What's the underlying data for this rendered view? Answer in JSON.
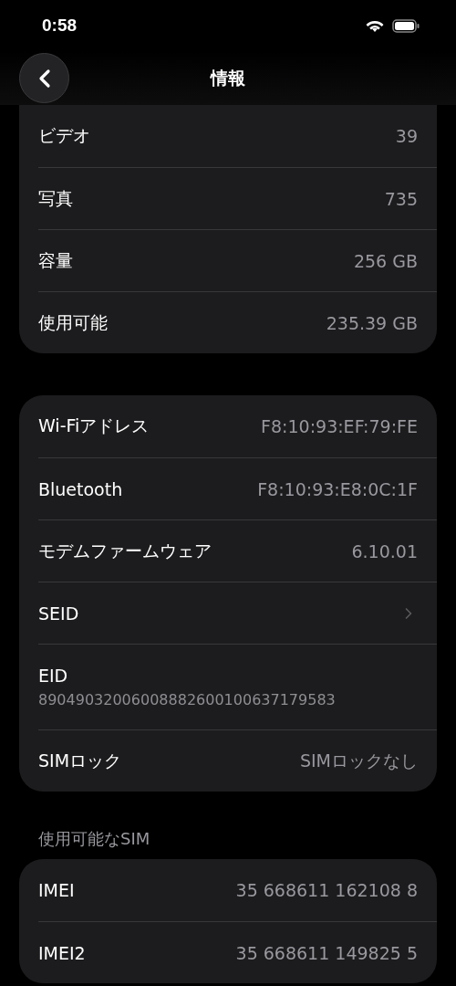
{
  "status_bar": {
    "time": "0:58"
  },
  "nav": {
    "title": "情報"
  },
  "sections": [
    {
      "rows": [
        {
          "kind": "value",
          "label": "ビデオ",
          "value": "39"
        },
        {
          "kind": "value",
          "label": "写真",
          "value": "735"
        },
        {
          "kind": "value",
          "label": "容量",
          "value": "256 GB"
        },
        {
          "kind": "value",
          "label": "使用可能",
          "value": "235.39 GB"
        }
      ]
    },
    {
      "rows": [
        {
          "kind": "value",
          "label": "Wi-Fiアドレス",
          "value": "F8:10:93:EF:79:FE"
        },
        {
          "kind": "value",
          "label": "Bluetooth",
          "value": "F8:10:93:E8:0C:1F"
        },
        {
          "kind": "value",
          "label": "モデムファームウェア",
          "value": "6.10.01"
        },
        {
          "kind": "link",
          "label": "SEID"
        },
        {
          "kind": "stacked",
          "label": "EID",
          "value": "89049032006008882600100637179583"
        },
        {
          "kind": "value",
          "label": "SIMロック",
          "value": "SIMロックなし"
        }
      ]
    },
    {
      "header": "使用可能なSIM",
      "rows": [
        {
          "kind": "value",
          "label": "IMEI",
          "value": "35 668611 162108 8"
        },
        {
          "kind": "value",
          "label": "IMEI2",
          "value": "35 668611 149825 5"
        }
      ]
    }
  ]
}
